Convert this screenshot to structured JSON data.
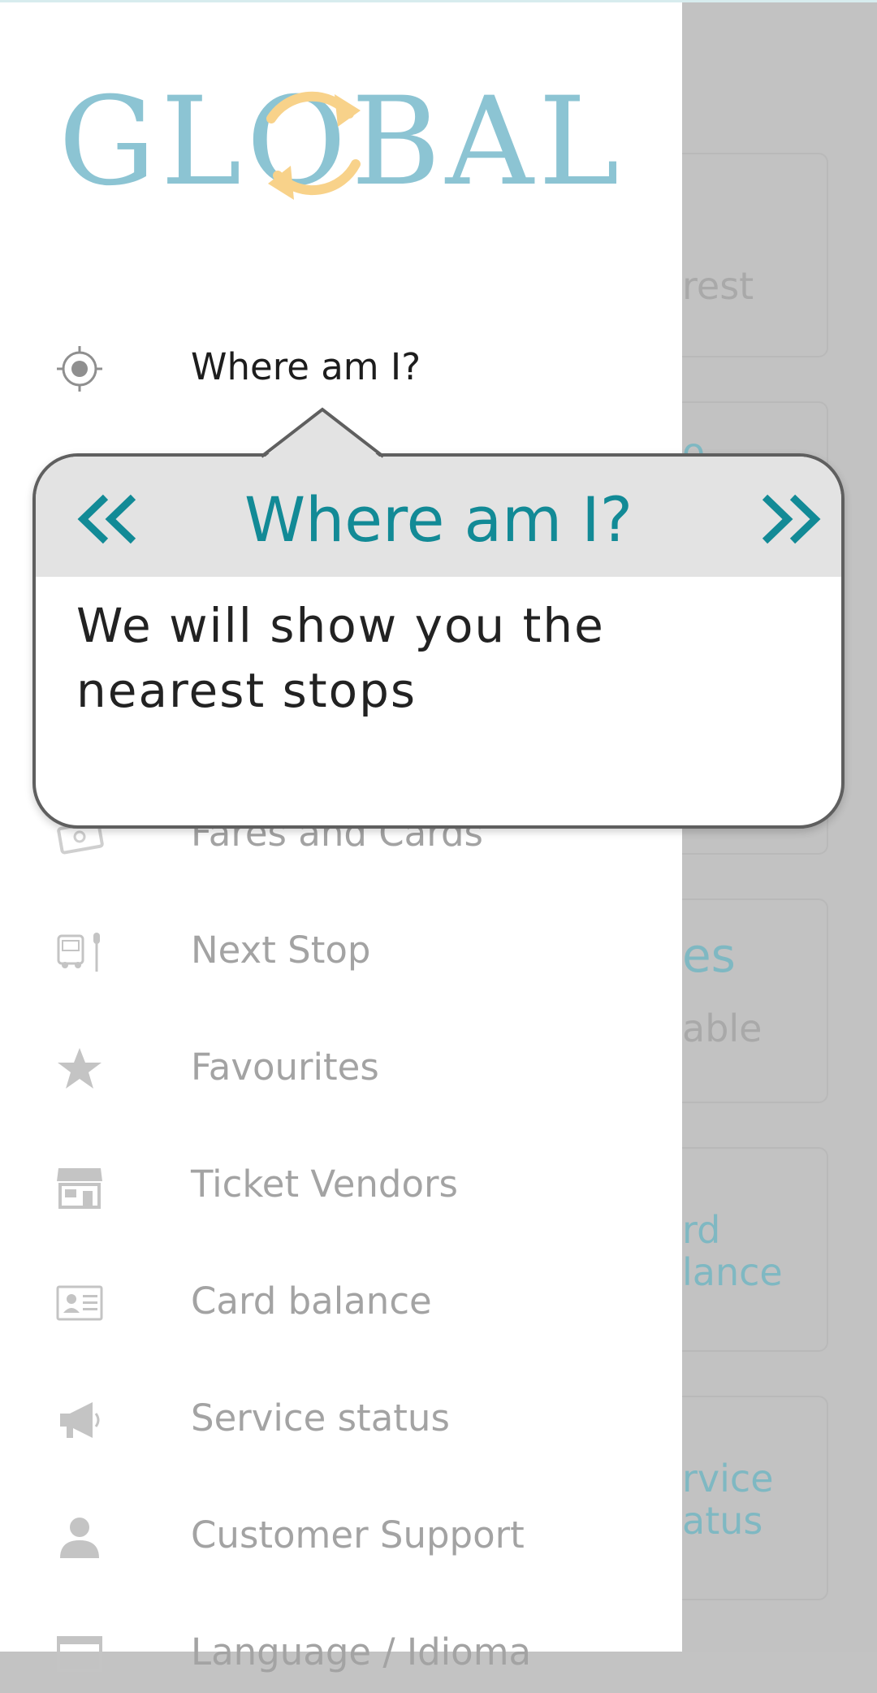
{
  "app": {
    "logo_text": "GLOBAL"
  },
  "background_cards": [
    {
      "lines": "rest",
      "tone": "gray"
    },
    {
      "lines": "o",
      "tone": "teal"
    },
    {
      "lines": "",
      "tone": "gray"
    },
    {
      "lines": "es",
      "tone": "teal",
      "sub": "able"
    },
    {
      "lines": "rd\nlance",
      "tone": "teal"
    },
    {
      "lines": "rvice\natus",
      "tone": "teal"
    }
  ],
  "menu": {
    "items": [
      {
        "label": "Where am I?",
        "icon": "target-icon"
      },
      {
        "label": "Fares and Cards",
        "icon": "tickets-icon"
      },
      {
        "label": "Next Stop",
        "icon": "bus-stop-icon"
      },
      {
        "label": "Favourites",
        "icon": "star-icon"
      },
      {
        "label": "Ticket Vendors",
        "icon": "store-icon"
      },
      {
        "label": "Card balance",
        "icon": "id-card-icon"
      },
      {
        "label": "Service status",
        "icon": "megaphone-icon"
      },
      {
        "label": "Customer Support",
        "icon": "person-icon"
      },
      {
        "label": "Language / Idioma",
        "icon": "language-icon"
      }
    ]
  },
  "tooltip": {
    "title": "Where am I?",
    "body": "We will show you the nearest stops",
    "prev_icon": "double-chevron-left-icon",
    "next_icon": "double-chevron-right-icon"
  },
  "colors": {
    "accent": "#128a96",
    "logo_blue": "#8cc4d3",
    "logo_yellow": "#f8d28a",
    "overlay": "#c2c2c2"
  }
}
